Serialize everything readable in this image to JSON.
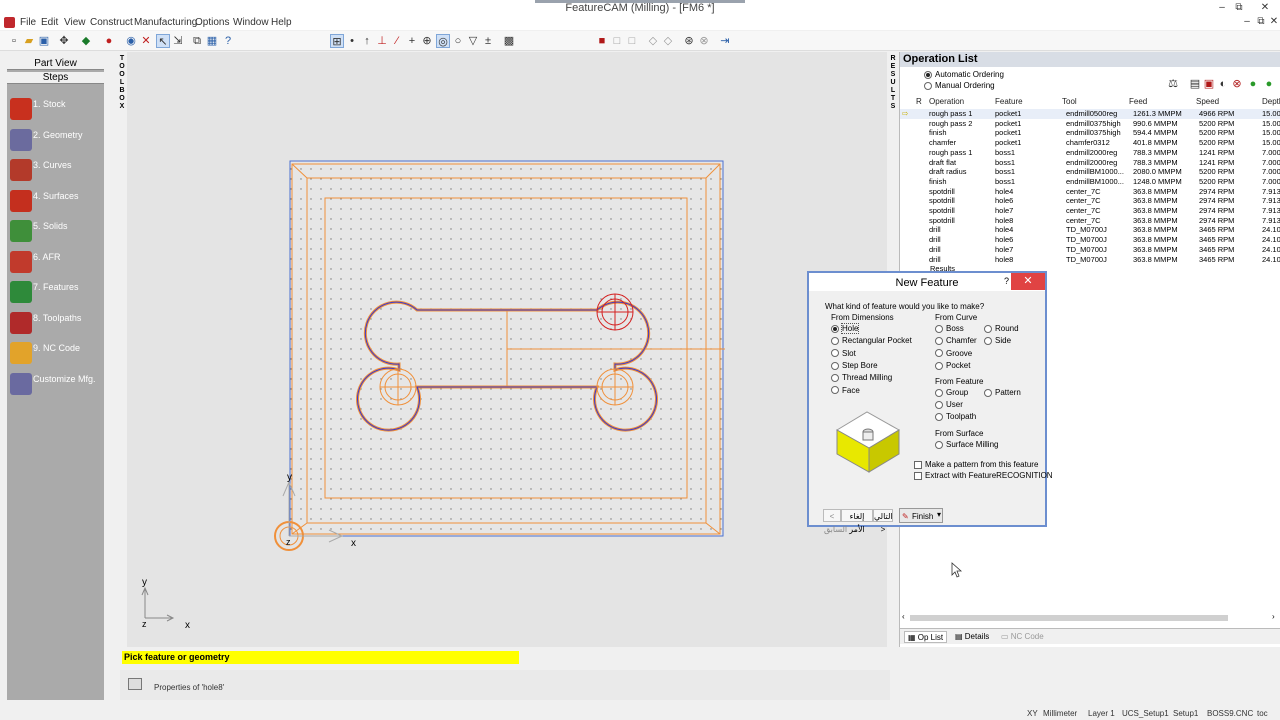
{
  "window": {
    "title": "FeatureCAM (Milling) - [FM6 *]",
    "minimize": "–",
    "restore": "⧉",
    "close": "✕"
  },
  "menu": {
    "items": [
      "File",
      "Edit",
      "View",
      "Construct",
      "Manufacturing",
      "Options",
      "Window",
      "Help"
    ]
  },
  "steps_panel": {
    "part_view": "Part View",
    "steps": "Steps",
    "items": [
      {
        "label": "1. Stock",
        "color": "#c8301e",
        "icon": "stock-icon"
      },
      {
        "label": "2. Geometry",
        "color": "#6b6b9e",
        "icon": "geometry-icon"
      },
      {
        "label": "3. Curves",
        "color": "#b33a2a",
        "icon": "curves-icon"
      },
      {
        "label": "4. Surfaces",
        "color": "#c42f1e",
        "icon": "surfaces-icon"
      },
      {
        "label": "5. Solids",
        "color": "#3f8f3a",
        "icon": "solids-icon"
      },
      {
        "label": "6. AFR",
        "color": "#c13a2c",
        "icon": "afr-icon"
      },
      {
        "label": "7. Features",
        "color": "#2e8a3a",
        "icon": "features-icon"
      },
      {
        "label": "8. Toolpaths",
        "color": "#b02a2a",
        "icon": "toolpaths-icon"
      },
      {
        "label": "9. NC Code",
        "color": "#e2a32a",
        "icon": "nc-code-icon"
      },
      {
        "label": "Customize Mfg.",
        "color": "#6a6aa0",
        "icon": "customize-icon"
      }
    ]
  },
  "strips": {
    "toolbox": [
      "T",
      "O",
      "O",
      "L",
      "B",
      "O",
      "X"
    ],
    "results": [
      "R",
      "E",
      "S",
      "U",
      "L",
      "T",
      "S"
    ]
  },
  "viewport": {
    "axis_x": "x",
    "axis_y": "y",
    "axis_z": "z",
    "mini_x": "x",
    "mini_y": "y",
    "mini_z": "z"
  },
  "prompt": "Pick feature or geometry",
  "properties": "Properties of 'hole8'",
  "oplist": {
    "title": "Operation List",
    "automatic": "Automatic Ordering",
    "manual": "Manual Ordering",
    "columns": {
      "r": "R",
      "operation": "Operation",
      "feature": "Feature",
      "tool": "Tool",
      "feed": "Feed",
      "speed": "Speed",
      "depth": "Depth"
    },
    "rows": [
      {
        "op": "rough pass 1",
        "feature": "pocket1",
        "tool": "endmill0500reg",
        "feed": "1261.3 MMPM",
        "speed": "4966 RPM",
        "depth": "15.00"
      },
      {
        "op": "rough pass 2",
        "feature": "pocket1",
        "tool": "endmill0375high",
        "feed": "990.6 MMPM",
        "speed": "5200 RPM",
        "depth": "15.00"
      },
      {
        "op": "finish",
        "feature": "pocket1",
        "tool": "endmill0375high",
        "feed": "594.4 MMPM",
        "speed": "5200 RPM",
        "depth": "15.00"
      },
      {
        "op": "chamfer",
        "feature": "pocket1",
        "tool": "chamfer0312",
        "feed": "401.8 MMPM",
        "speed": "5200 RPM",
        "depth": "15.00"
      },
      {
        "op": "rough pass 1",
        "feature": "boss1",
        "tool": "endmill2000reg",
        "feed": "788.3 MMPM",
        "speed": "1241 RPM",
        "depth": "7.000"
      },
      {
        "op": "draft flat",
        "feature": "boss1",
        "tool": "endmill2000reg",
        "feed": "788.3 MMPM",
        "speed": "1241 RPM",
        "depth": "7.000"
      },
      {
        "op": "draft radius",
        "feature": "boss1",
        "tool": "endmillBM1000...",
        "feed": "2080.0 MMPM",
        "speed": "5200 RPM",
        "depth": "7.000"
      },
      {
        "op": "finish",
        "feature": "boss1",
        "tool": "endmillBM1000...",
        "feed": "1248.0 MMPM",
        "speed": "5200 RPM",
        "depth": "7.000"
      },
      {
        "op": "spotdrill",
        "feature": "hole4",
        "tool": "center_7C",
        "feed": "363.8 MMPM",
        "speed": "2974 RPM",
        "depth": "7.913"
      },
      {
        "op": "spotdrill",
        "feature": "hole6",
        "tool": "center_7C",
        "feed": "363.8 MMPM",
        "speed": "2974 RPM",
        "depth": "7.913"
      },
      {
        "op": "spotdrill",
        "feature": "hole7",
        "tool": "center_7C",
        "feed": "363.8 MMPM",
        "speed": "2974 RPM",
        "depth": "7.913"
      },
      {
        "op": "spotdrill",
        "feature": "hole8",
        "tool": "center_7C",
        "feed": "363.8 MMPM",
        "speed": "2974 RPM",
        "depth": "7.913"
      },
      {
        "op": "drill",
        "feature": "hole4",
        "tool": "TD_M0700J",
        "feed": "363.8 MMPM",
        "speed": "3465 RPM",
        "depth": "24.10"
      },
      {
        "op": "drill",
        "feature": "hole6",
        "tool": "TD_M0700J",
        "feed": "363.8 MMPM",
        "speed": "3465 RPM",
        "depth": "24.10"
      },
      {
        "op": "drill",
        "feature": "hole7",
        "tool": "TD_M0700J",
        "feed": "363.8 MMPM",
        "speed": "3465 RPM",
        "depth": "24.10"
      },
      {
        "op": "drill",
        "feature": "hole8",
        "tool": "TD_M0700J",
        "feed": "363.8 MMPM",
        "speed": "3465 RPM",
        "depth": "24.10"
      }
    ],
    "results_row": "Results",
    "tabs": [
      "Op List",
      "Details",
      "NC Code"
    ]
  },
  "dialog": {
    "title": "New Feature",
    "help": "?",
    "close": "✕",
    "question": "What kind of feature would you like to make?",
    "from_dimensions": "From Dimensions",
    "dimension_options": [
      "Hole",
      "Rectangular Pocket",
      "Slot",
      "Step Bore",
      "Thread Milling",
      "Face"
    ],
    "from_curve": "From Curve",
    "curve_options_left": [
      "Boss",
      "Chamfer",
      "Groove",
      "Pocket"
    ],
    "curve_options_right": [
      "Round",
      "Side"
    ],
    "from_feature": "From Feature",
    "feature_options_left": [
      "Group",
      "User",
      "Toolpath"
    ],
    "feature_options_right": [
      "Pattern"
    ],
    "from_surface": "From Surface",
    "surface_options": [
      "Surface Milling"
    ],
    "make_pattern": "Make a pattern from this feature",
    "extract": "Extract with FeatureRECOGNITION",
    "btn_prev": "< السابق",
    "btn_cancel": "إلغاء الأمر",
    "btn_next": "التالي >",
    "btn_finish": "Finish"
  },
  "statusbar": {
    "plane": "XY",
    "units": "Millimeter",
    "layer": "Layer 1",
    "ucs": "UCS_Setup1",
    "setup": "Setup1",
    "file": "BOSS9.CNC",
    "toc": "toc"
  },
  "colors": {
    "orange": "#f0903a",
    "blue": "#3a3acf",
    "red": "#d42020",
    "yellow": "#ffff00"
  }
}
